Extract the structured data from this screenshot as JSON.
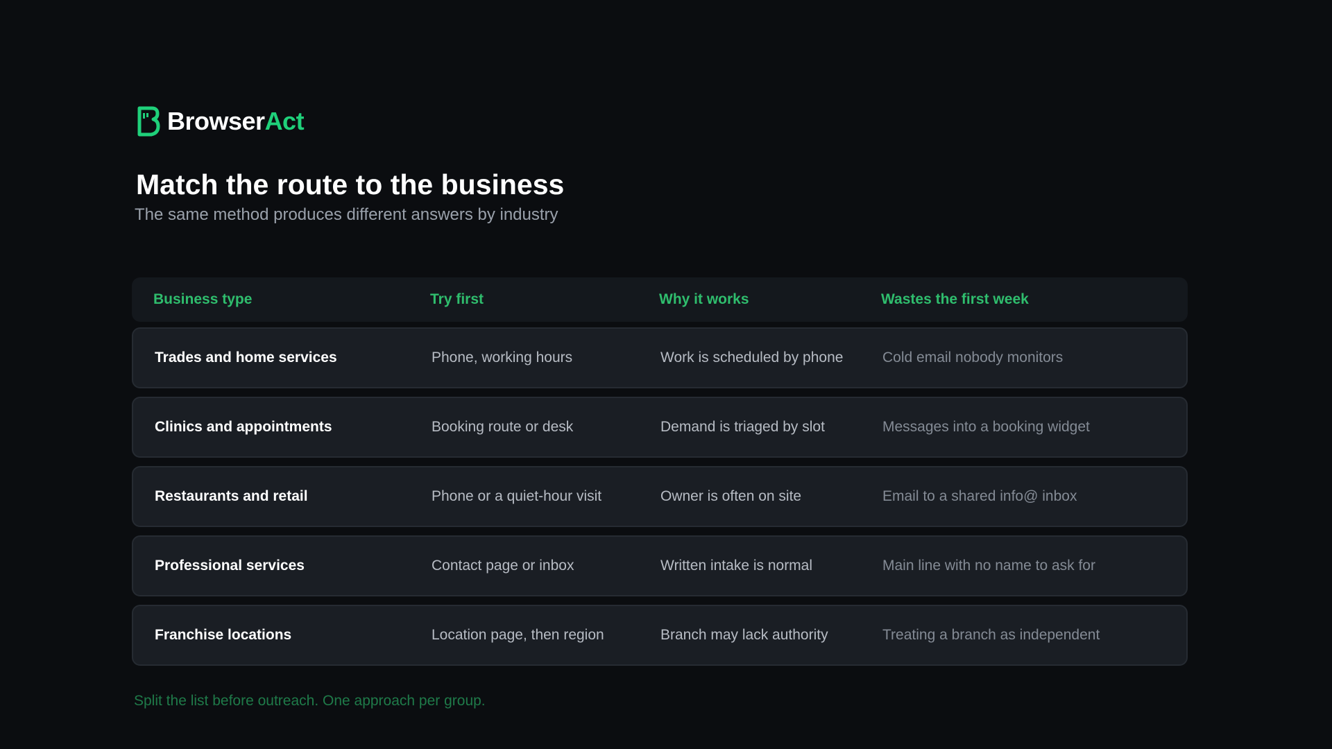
{
  "brand": {
    "name_part1": "Browser",
    "name_part2": "Act",
    "icon": "browseract-logo-icon",
    "colors": {
      "accent": "#1fd07a",
      "header_text": "#2fbd6d",
      "footer_text": "#1f7a49",
      "background": "#0b0d10"
    }
  },
  "page": {
    "title": "Match the route to the business",
    "subtitle": "The same method produces different answers by industry"
  },
  "table": {
    "headers": [
      "Business type",
      "Try first",
      "Why it works",
      "Wastes the first week"
    ],
    "rows": [
      [
        "Trades and home services",
        "Phone, working hours",
        "Work is scheduled by phone",
        "Cold email nobody monitors"
      ],
      [
        "Clinics and appointments",
        "Booking route or desk",
        "Demand is triaged by slot",
        "Messages into a booking widget"
      ],
      [
        "Restaurants and retail",
        "Phone or a quiet-hour visit",
        "Owner is often on site",
        "Email to a shared info@ inbox"
      ],
      [
        "Professional services",
        "Contact page or inbox",
        "Written intake is normal",
        "Main line with no name to ask for"
      ],
      [
        "Franchise locations",
        "Location page, then region",
        "Branch may lack authority",
        "Treating a branch as independent"
      ]
    ]
  },
  "footer": {
    "note": "Split the list before outreach. One approach per group."
  }
}
